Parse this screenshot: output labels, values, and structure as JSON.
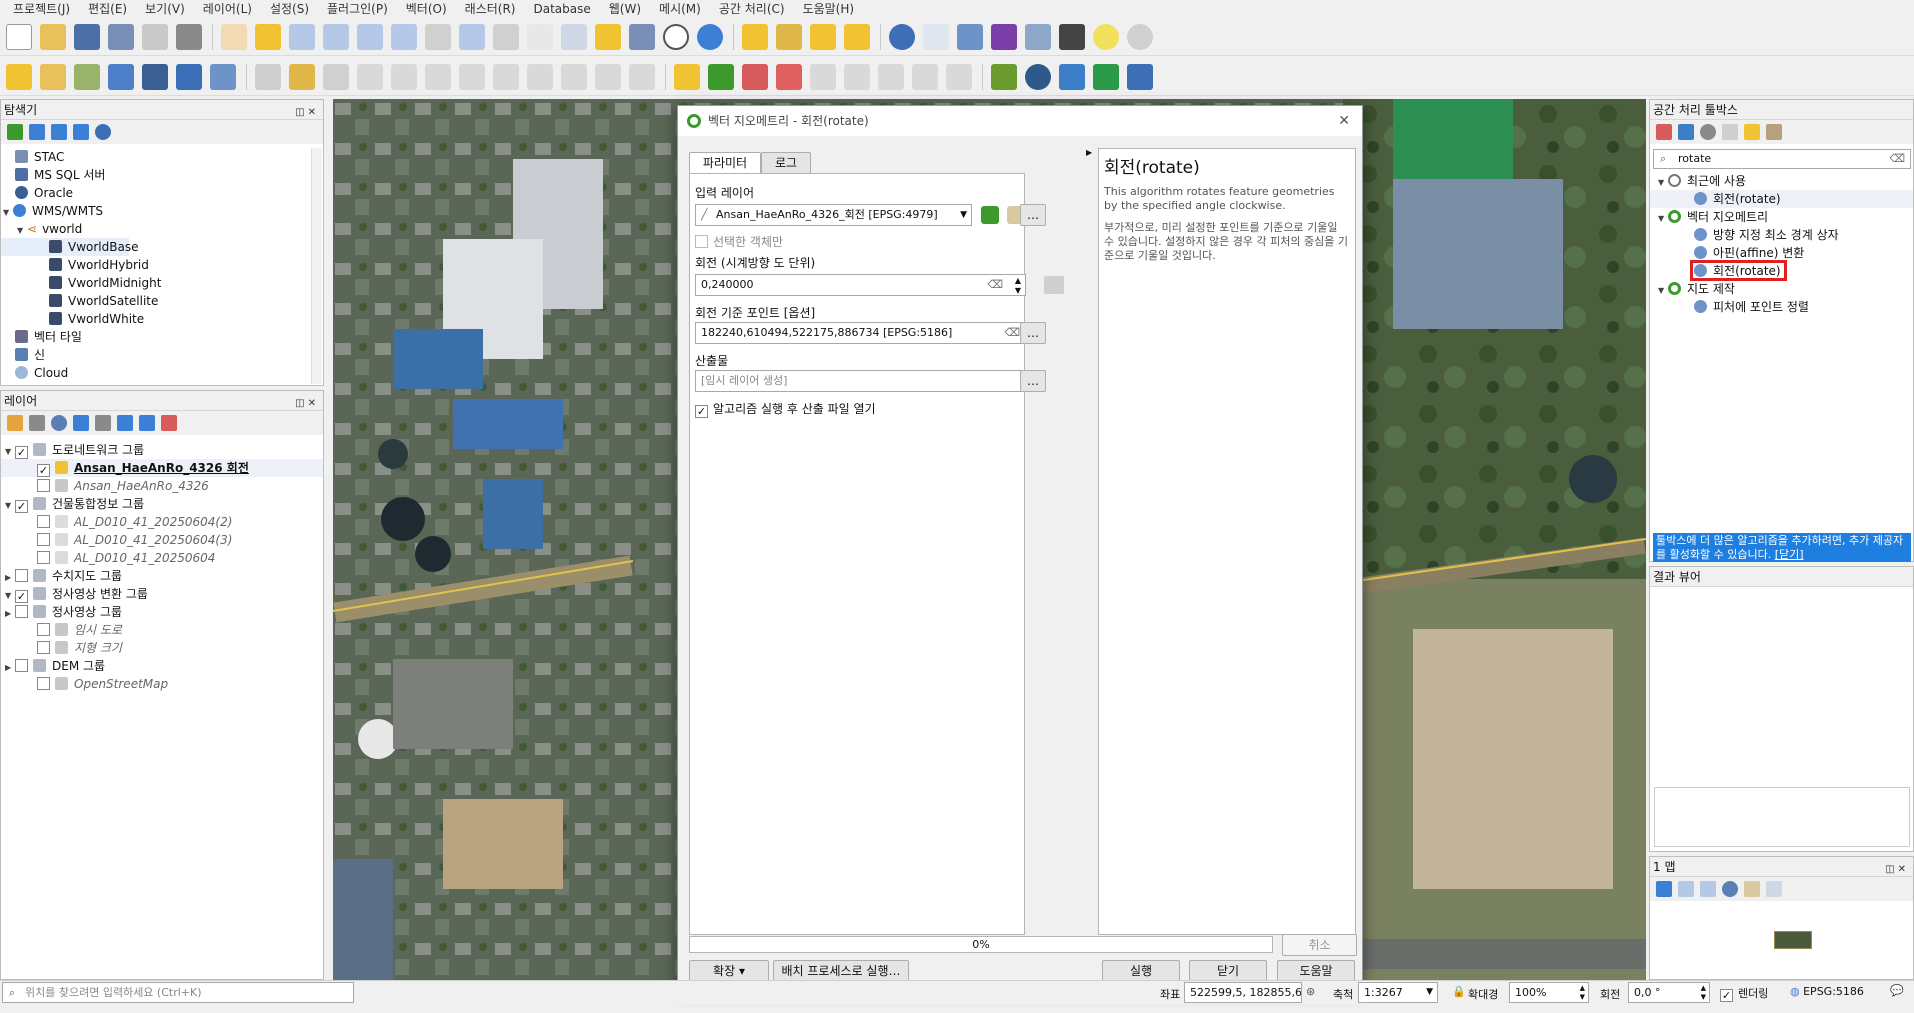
{
  "menu": [
    "프로젝트(J)",
    "편집(E)",
    "보기(V)",
    "레이어(L)",
    "설정(S)",
    "플러그인(P)",
    "벡터(O)",
    "래스터(R)",
    "Database",
    "웹(W)",
    "메시(M)",
    "공간 처리(C)",
    "도움말(H)"
  ],
  "browser": {
    "title": "탐색기",
    "items": [
      "STAC",
      "MS SQL 서버",
      "Oracle",
      "WMS/WMTS",
      "vworld",
      "VworldBase",
      "VworldHybrid",
      "VworldMidnight",
      "VworldSatellite",
      "VworldWhite",
      "벡터 타일",
      "신",
      "Cloud"
    ]
  },
  "layers": {
    "title": "레이어",
    "items": [
      {
        "label": "도로네트워크 그룹",
        "style": "group"
      },
      {
        "label": "Ansan_HaeAnRo_4326 회전",
        "style": "active"
      },
      {
        "label": "Ansan_HaeAnRo_4326",
        "style": "off"
      },
      {
        "label": "건물통합정보 그룹",
        "style": "group"
      },
      {
        "label": "AL_D010_41_20250604(2)",
        "style": "off"
      },
      {
        "label": "AL_D010_41_20250604(3)",
        "style": "off"
      },
      {
        "label": "AL_D010_41_20250604",
        "style": "off"
      },
      {
        "label": "수치지도 그룹",
        "style": "group-off"
      },
      {
        "label": "정사영상 변환 그룹",
        "style": "group"
      },
      {
        "label": "정사영상 그룹",
        "style": "group-off"
      },
      {
        "label": "임시 도로",
        "style": "off"
      },
      {
        "label": "지형 크기",
        "style": "off"
      },
      {
        "label": "DEM 그룹",
        "style": "group-off"
      },
      {
        "label": "OpenStreetMap",
        "style": "off"
      }
    ]
  },
  "dialog": {
    "title": "벡터 지오메트리 - 회전(rotate)",
    "tab_params": "파라미터",
    "tab_log": "로그",
    "input_layer_label": "입력 레이어",
    "input_layer_value": "Ansan_HaeAnRo_4326_회전 [EPSG:4979]",
    "selected_only": "선택한 객체만",
    "rotation_label": "회전 (시계방향 도 단위)",
    "rotation_value": "0,240000",
    "anchor_label": "회전 기준 포인트 [옵션]",
    "anchor_value": "182240,610494,522175,886734 [EPSG:5186]",
    "output_label": "산출물",
    "output_placeholder": "[임시 레이어 생성]",
    "open_after": "알고리즘 실행 후 산출 파일 열기",
    "help_title": "회전(rotate)",
    "help_en": "This algorithm rotates feature geometries by the specified angle clockwise.",
    "help_ko": "부가적으로, 미리 설정한 포인트를 기준으로 기울일 수 있습니다. 설정하지 않은 경우 각 피처의 중심을 기준으로 기울일 것입니다.",
    "progress": "0%",
    "cancel": "취소",
    "advanced": "확장",
    "batch": "배치 프로세스로 실행…",
    "run": "실행",
    "close": "닫기",
    "help": "도움말"
  },
  "toolbox": {
    "title": "공간 처리 툴박스",
    "search": "rotate",
    "recent": "최근에 사용",
    "recent_item": "회전(rotate)",
    "vg": "벡터 지오메트리",
    "vg_items": [
      "방향 지정 최소 경계 상자",
      "아핀(affine) 변환",
      "회전(rotate)"
    ],
    "carto": "지도 제작",
    "carto_item": "피처에 포인트 정렬",
    "notice": "툴박스에 더 많은 알고리즘을 추가하려면, 추가 제공자를 활성화할 수 있습니다.",
    "notice_link": "추가 제공자를 활성화할 수 있습니다.",
    "notice_close": "[닫기]"
  },
  "results": {
    "title": "결과 뷰어"
  },
  "map1": {
    "title": "1 맵"
  },
  "status": {
    "locate": "위치를 찾으려면 입력하세요 (Ctrl+K)",
    "coord_label": "좌표",
    "coord": "522599,5, 182855,6",
    "scale_label": "축척",
    "scale": "1:3267",
    "mag_label": "확대경",
    "mag": "100%",
    "rot_label": "회전",
    "rot": "0,0 °",
    "render": "렌더링",
    "crs": "EPSG:5186"
  },
  "colors": {
    "accent": "#3c9a2d",
    "highlight": "#e0201e",
    "link": "#1e5fd6"
  }
}
